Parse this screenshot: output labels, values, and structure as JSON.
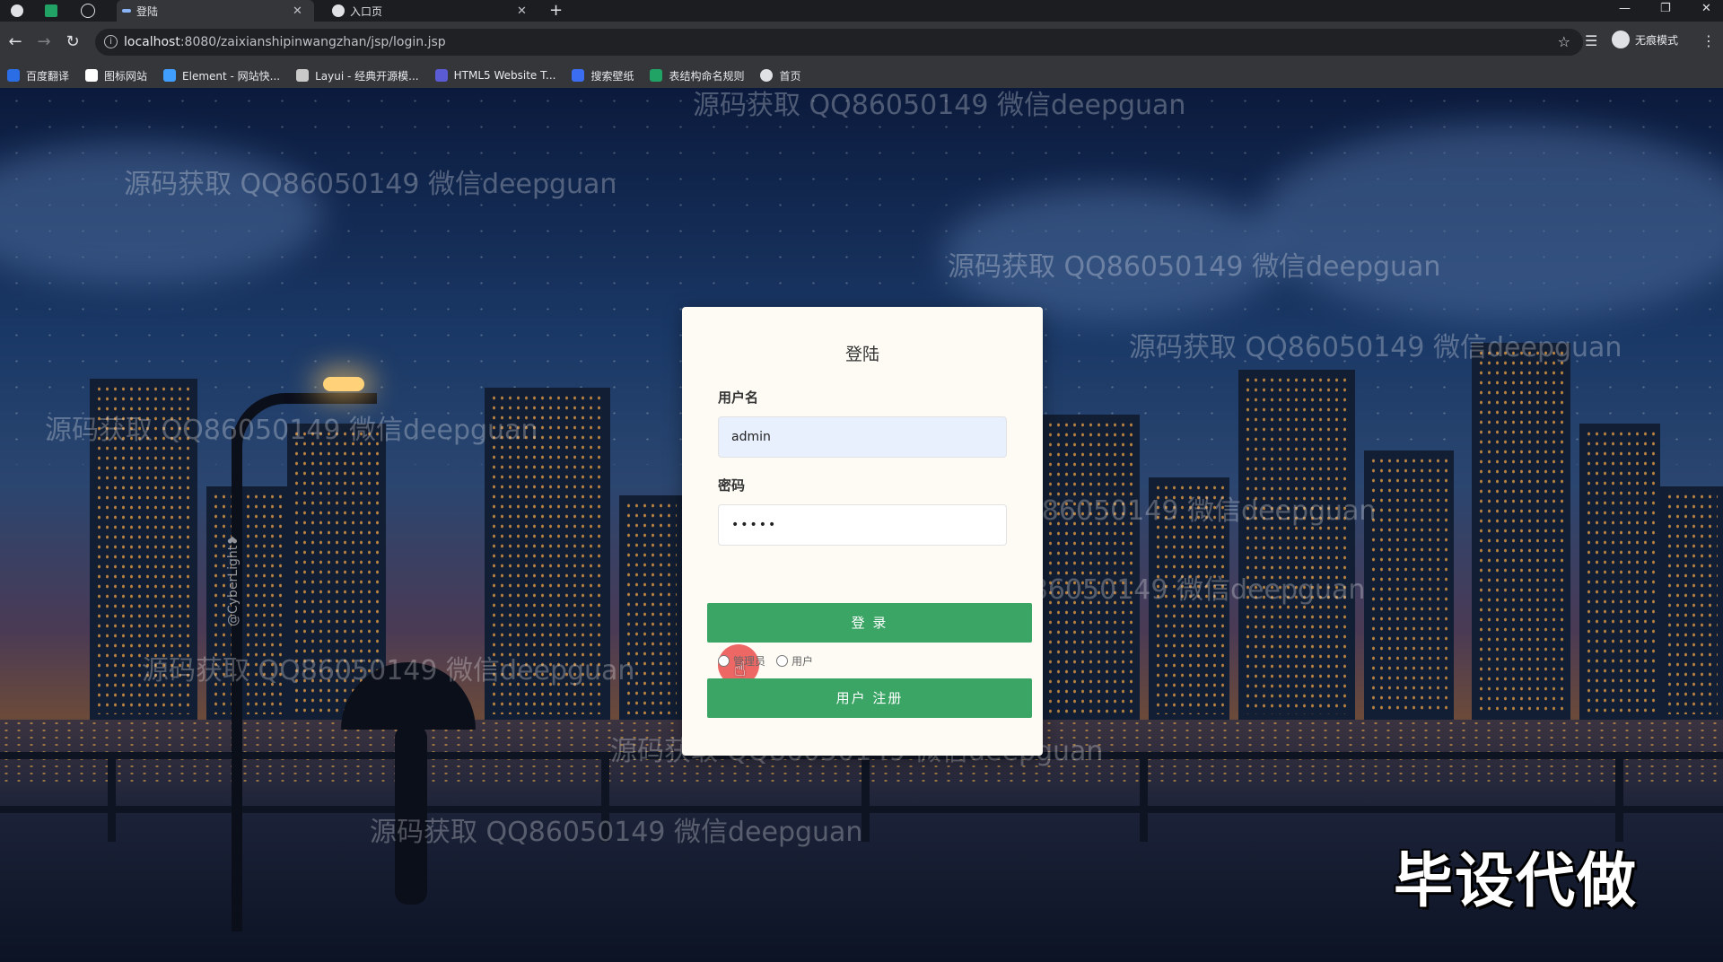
{
  "browser": {
    "tabs": [
      {
        "label": "",
        "icon": "globe-icon"
      },
      {
        "label": "",
        "icon": "sheet-icon"
      },
      {
        "label": "",
        "icon": "audio-icon"
      },
      {
        "label": "登陆",
        "icon": "loading-icon",
        "active": true
      },
      {
        "label": "入口页",
        "icon": "globe-icon"
      }
    ],
    "url_host": "localhost",
    "url_path": ":8080/zaixianshipinwangzhan/jsp/login.jsp",
    "profile_label": "无痕模式",
    "bookmarks": [
      {
        "label": "百度翻译",
        "color": "#2b6de5"
      },
      {
        "label": "图标网站",
        "color": "#ffffff"
      },
      {
        "label": "Element - 网站快...",
        "color": "#409eff"
      },
      {
        "label": "Layui - 经典开源模...",
        "color": "#c9c9c9"
      },
      {
        "label": "HTML5 Website T...",
        "color": "#5b5bd6"
      },
      {
        "label": "搜索壁纸",
        "color": "#3a6df0"
      },
      {
        "label": "表结构命名规则",
        "color": "#21a366"
      },
      {
        "label": "首页",
        "color": "#dfe1e5"
      }
    ]
  },
  "watermark_text": "源码获取 QQ86050149 微信deepguan",
  "credit_text": "@CyberLight❥",
  "corner_text": "毕设代做",
  "login": {
    "title": "登陆",
    "username_label": "用户名",
    "username_value": "admin",
    "password_label": "密码",
    "password_value": "•••••",
    "role_options": [
      "管理员",
      "用户"
    ],
    "login_button": "登 录",
    "register_button": "用户 注册"
  }
}
